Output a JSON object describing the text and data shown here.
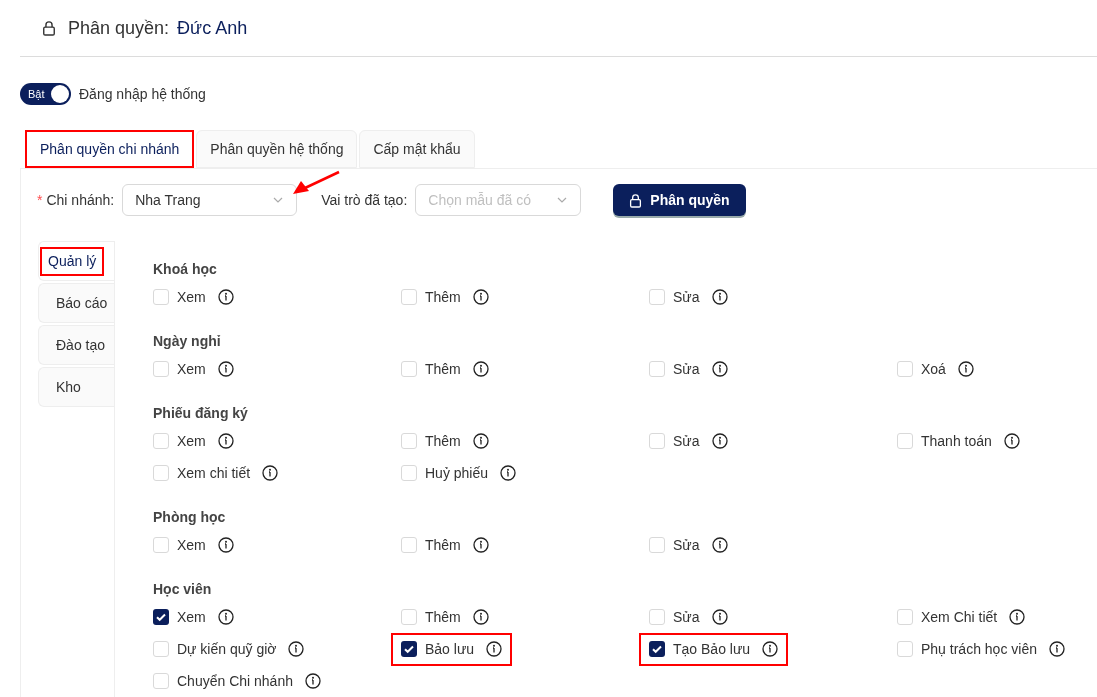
{
  "header": {
    "label": "Phân quyền:",
    "user": "Đức Anh"
  },
  "login_toggle": {
    "on": true,
    "badge": "Bật",
    "label": "Đăng nhập hệ thống"
  },
  "tabs": [
    {
      "label": "Phân quyền chi nhánh",
      "selected": true,
      "highlighted": true
    },
    {
      "label": "Phân quyền hệ thống",
      "selected": false,
      "highlighted": false
    },
    {
      "label": "Cấp mật khẩu",
      "selected": false,
      "highlighted": false
    }
  ],
  "filters": {
    "branch": {
      "required_mark": "*",
      "label": "Chi nhánh:",
      "value": "Nha Trang",
      "pointed": true
    },
    "role": {
      "label": "Vai trò đã tạo:",
      "placeholder": "Chọn mẫu đã có"
    },
    "button": "Phân quyền"
  },
  "side_tabs": [
    {
      "label": "Quản lý",
      "selected": true,
      "highlighted": true
    },
    {
      "label": "Báo cáo",
      "selected": false,
      "highlighted": false
    },
    {
      "label": "Đào tạo",
      "selected": false,
      "highlighted": false
    },
    {
      "label": "Kho",
      "selected": false,
      "highlighted": false
    }
  ],
  "groups": [
    {
      "title": "Khoá học",
      "items": [
        {
          "label": "Xem",
          "checked": false,
          "highlighted": false
        },
        {
          "label": "Thêm",
          "checked": false,
          "highlighted": false
        },
        {
          "label": "Sửa",
          "checked": false,
          "highlighted": false
        }
      ]
    },
    {
      "title": "Ngày nghỉ",
      "items": [
        {
          "label": "Xem",
          "checked": false,
          "highlighted": false
        },
        {
          "label": "Thêm",
          "checked": false,
          "highlighted": false
        },
        {
          "label": "Sửa",
          "checked": false,
          "highlighted": false
        },
        {
          "label": "Xoá",
          "checked": false,
          "highlighted": false
        }
      ]
    },
    {
      "title": "Phiếu đăng ký",
      "items": [
        {
          "label": "Xem",
          "checked": false,
          "highlighted": false
        },
        {
          "label": "Thêm",
          "checked": false,
          "highlighted": false
        },
        {
          "label": "Sửa",
          "checked": false,
          "highlighted": false
        },
        {
          "label": "Thanh toán",
          "checked": false,
          "highlighted": false
        },
        {
          "label": "Xem chi tiết",
          "checked": false,
          "highlighted": false
        },
        {
          "label": "Huỷ phiếu",
          "checked": false,
          "highlighted": false
        }
      ]
    },
    {
      "title": "Phòng học",
      "items": [
        {
          "label": "Xem",
          "checked": false,
          "highlighted": false
        },
        {
          "label": "Thêm",
          "checked": false,
          "highlighted": false
        },
        {
          "label": "Sửa",
          "checked": false,
          "highlighted": false
        }
      ]
    },
    {
      "title": "Học viên",
      "items": [
        {
          "label": "Xem",
          "checked": true,
          "highlighted": false
        },
        {
          "label": "Thêm",
          "checked": false,
          "highlighted": false
        },
        {
          "label": "Sửa",
          "checked": false,
          "highlighted": false
        },
        {
          "label": "Xem Chi tiết",
          "checked": false,
          "highlighted": false
        },
        {
          "label": "Dự kiến quỹ giờ",
          "checked": false,
          "highlighted": false
        },
        {
          "label": "Bảo lưu",
          "checked": true,
          "highlighted": true
        },
        {
          "label": "Tạo Bảo lưu",
          "checked": true,
          "highlighted": true
        },
        {
          "label": "Phụ trách học viên",
          "checked": false,
          "highlighted": false
        },
        {
          "label": "Chuyển Chi nhánh",
          "checked": false,
          "highlighted": false
        }
      ]
    }
  ]
}
